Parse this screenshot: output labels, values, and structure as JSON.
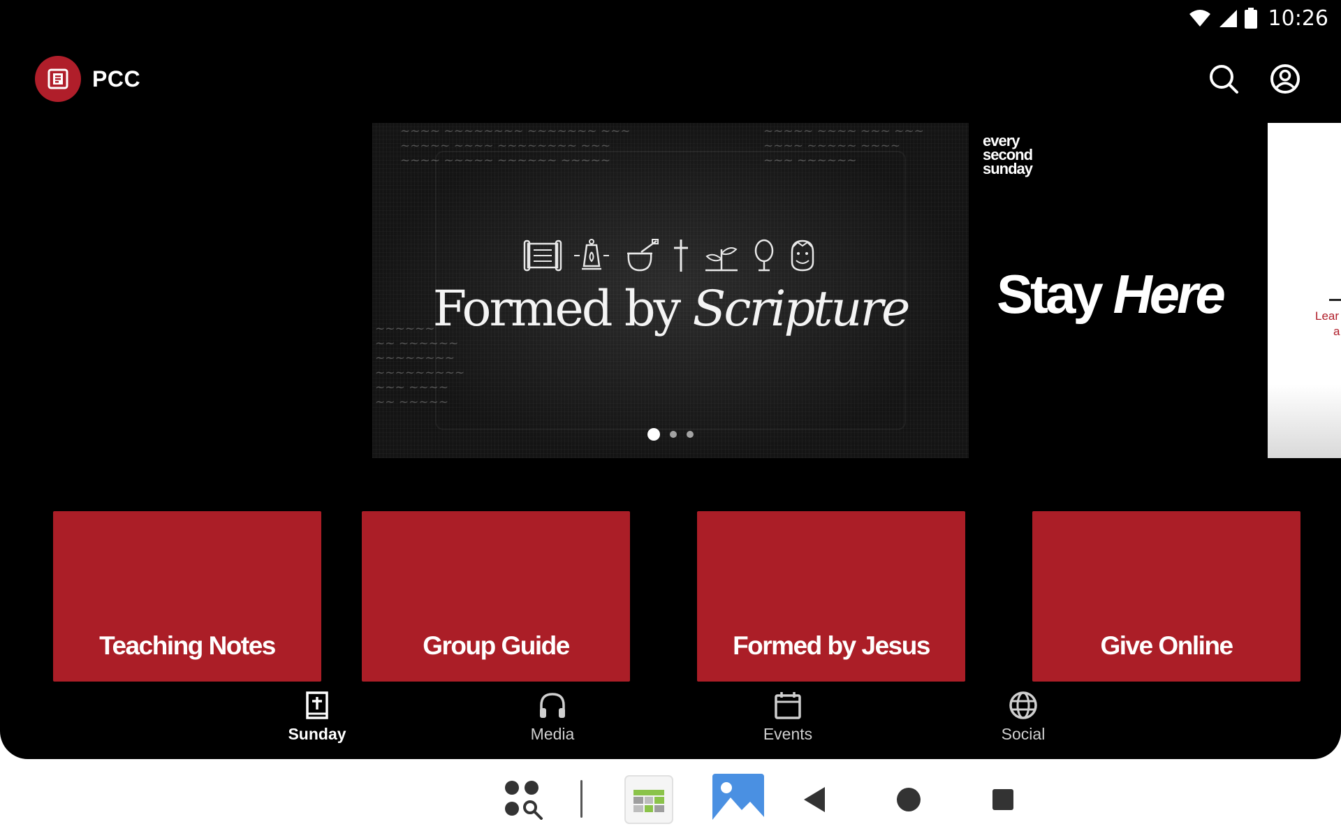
{
  "status_bar": {
    "time": "10:26"
  },
  "app_bar": {
    "title": "PCC"
  },
  "carousel": {
    "main_slide": {
      "title_regular": "Formed by ",
      "title_italic": "Scripture",
      "symbols": [
        "scroll-icon",
        "lantern-icon",
        "honey-pot-icon",
        "sword-icon",
        "sprout-icon",
        "mirror-icon",
        "crowned-face-icon"
      ]
    },
    "next_slide": {
      "tagline": [
        "every",
        "second",
        "sunday"
      ],
      "title_regular": "Stay ",
      "title_italic": "Here"
    },
    "peek_slide": {
      "text": [
        "Lear",
        "a"
      ]
    },
    "pagination": {
      "count": 3,
      "active_index": 0
    }
  },
  "tiles": [
    {
      "label": "Teaching Notes"
    },
    {
      "label": "Group Guide"
    },
    {
      "label": "Formed by Jesus"
    },
    {
      "label": "Give Online"
    }
  ],
  "bottom_nav": [
    {
      "label": "Sunday",
      "icon": "bible-icon",
      "active": true
    },
    {
      "label": "Media",
      "icon": "headphones-icon",
      "active": false
    },
    {
      "label": "Events",
      "icon": "calendar-icon",
      "active": false
    },
    {
      "label": "Social",
      "icon": "globe-icon",
      "active": false
    }
  ],
  "colors": {
    "accent": "#ab1e27",
    "logo": "#b01e2a",
    "background": "#000000"
  }
}
